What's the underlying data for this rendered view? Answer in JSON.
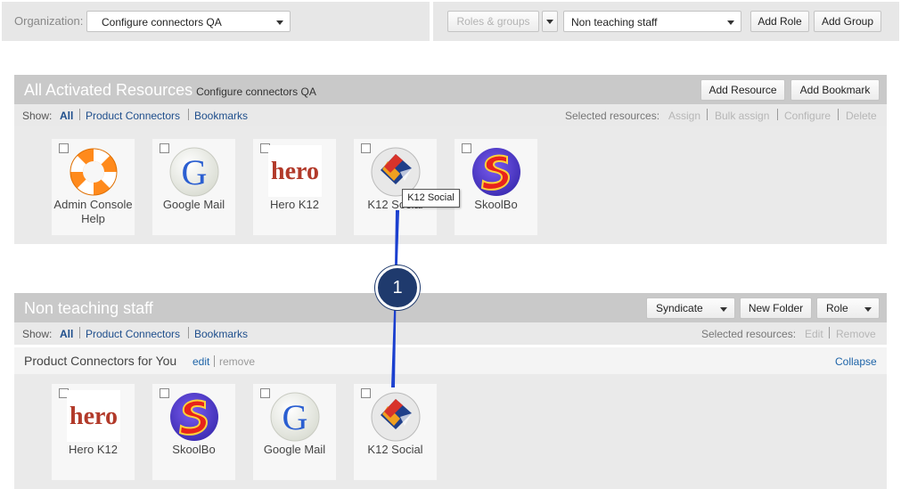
{
  "topbar": {
    "org_label": "Organization:",
    "org_value": "Configure connectors QA",
    "roles_groups_label": "Roles & groups",
    "role_select_value": "Non teaching staff",
    "add_role_label": "Add Role",
    "add_group_label": "Add Group"
  },
  "activated": {
    "title": "All Activated Resources",
    "subtitle": "Configure connectors QA",
    "add_resource_label": "Add Resource",
    "add_bookmark_label": "Add Bookmark",
    "show_label": "Show:",
    "filters": [
      "All",
      "Product Connectors",
      "Bookmarks"
    ],
    "selected_label": "Selected resources:",
    "actions": [
      "Assign",
      "Bulk assign",
      "Configure",
      "Delete"
    ],
    "tiles": [
      {
        "label": "Admin Console Help",
        "icon": "lifebuoy-icon"
      },
      {
        "label": "Google Mail",
        "icon": "google-g-icon"
      },
      {
        "label": "Hero K12",
        "icon": "hero-logo-icon"
      },
      {
        "label": "K12 Social",
        "icon": "k12-social-icon"
      },
      {
        "label": "SkoolBo",
        "icon": "skoolbo-logo-icon"
      }
    ]
  },
  "tooltip": "K12 Social",
  "staff": {
    "title": "Non teaching staff",
    "syndicate_label": "Syndicate",
    "new_folder_label": "New Folder",
    "role_label": "Role",
    "show_label": "Show:",
    "filters": [
      "All",
      "Product Connectors",
      "Bookmarks"
    ],
    "selected_label": "Selected resources:",
    "actions": [
      "Edit",
      "Remove"
    ],
    "folder_title": "Product Connectors for You",
    "folder_edit": "edit",
    "folder_remove": "remove",
    "collapse_label": "Collapse",
    "tiles": [
      {
        "label": "Hero K12",
        "icon": "hero-logo-icon"
      },
      {
        "label": "SkoolBo",
        "icon": "skoolbo-logo-icon"
      },
      {
        "label": "Google Mail",
        "icon": "google-g-icon"
      },
      {
        "label": "K12 Social",
        "icon": "k12-social-icon"
      }
    ]
  },
  "callout_number": "1",
  "colors": {
    "header_bg": "#c9c9c9",
    "link": "#1e4e8c",
    "callout": "#1f3a6d",
    "callout_line": "#1a3fcf"
  }
}
